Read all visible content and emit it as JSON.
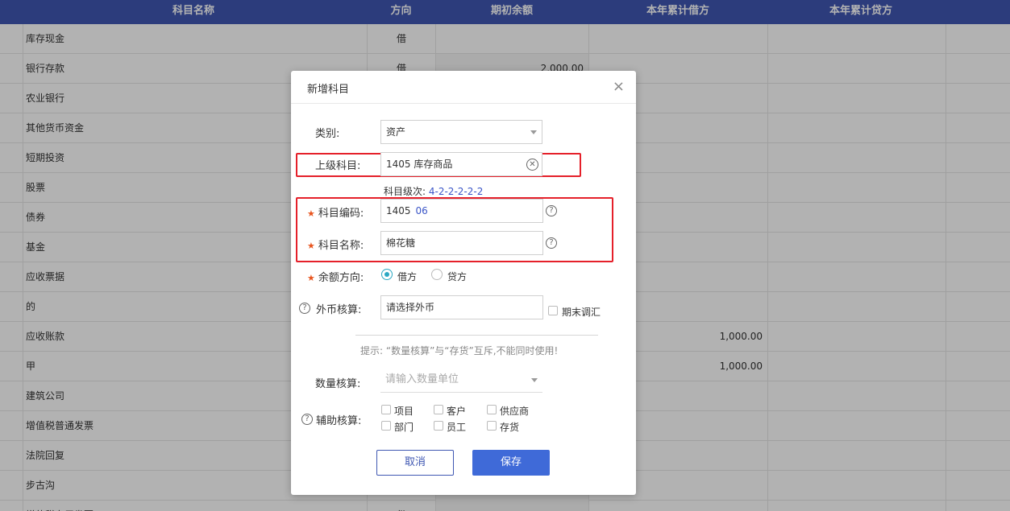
{
  "table": {
    "headers": {
      "name": "科目名称",
      "direction": "方向",
      "opening": "期初余额",
      "debit": "本年累计借方",
      "credit": "本年累计贷方"
    },
    "rows": [
      {
        "name": "库存现金",
        "direction": "借",
        "opening": "",
        "debit": ""
      },
      {
        "name": "银行存款",
        "direction": "借",
        "opening": "2,000.00",
        "debit": ""
      },
      {
        "name": "农业银行",
        "direction": "",
        "opening": "",
        "debit": ""
      },
      {
        "name": "其他货币资金",
        "direction": "",
        "opening": "",
        "debit": ""
      },
      {
        "name": "短期投资",
        "direction": "",
        "opening": "",
        "debit": ""
      },
      {
        "name": "股票",
        "direction": "",
        "opening": "",
        "debit": ""
      },
      {
        "name": "债券",
        "direction": "",
        "opening": "",
        "debit": ""
      },
      {
        "name": "基金",
        "direction": "",
        "opening": "",
        "debit": ""
      },
      {
        "name": "应收票据",
        "direction": "",
        "opening": "",
        "debit": ""
      },
      {
        "name": "的",
        "direction": "",
        "opening": "",
        "debit": ""
      },
      {
        "name": "应收账款",
        "direction": "",
        "opening": "",
        "debit": "1,000.00"
      },
      {
        "name": "甲",
        "direction": "",
        "opening": "",
        "debit": "1,000.00"
      },
      {
        "name": "建筑公司",
        "direction": "",
        "opening": "",
        "debit": ""
      },
      {
        "name": "增值税普通发票",
        "direction": "",
        "opening": "",
        "debit": ""
      },
      {
        "name": "法院回复",
        "direction": "",
        "opening": "",
        "debit": ""
      },
      {
        "name": "步古沟",
        "direction": "",
        "opening": "",
        "debit": ""
      },
      {
        "name": "增值税专用发票",
        "direction": "借",
        "opening": "",
        "debit": ""
      }
    ]
  },
  "dialog": {
    "title": "新增科目",
    "close_glyph": "×",
    "category_label": "类别:",
    "category_value": "资产",
    "parent_label": "上级科目:",
    "parent_value": "1405 库存商品",
    "level_prefix": "科目级次:",
    "level_first": "4",
    "level_rest": "-2-2-2-2-2",
    "code_label": "科目编码:",
    "code_prefix": "1405",
    "code_suffix": "06",
    "name_label": "科目名称:",
    "name_value": "棉花糖",
    "balance_label": "余额方向:",
    "balance_options": [
      "借方",
      "贷方"
    ],
    "balance_selected": "借方",
    "currency_label": "外币核算:",
    "currency_placeholder": "请选择外币",
    "period_end_label": "期末调汇",
    "hint": "提示: “数量核算”与“存货”互斥,不能同时使用!",
    "quantity_label": "数量核算:",
    "quantity_placeholder": "请输入数量单位",
    "aux_label": "辅助核算:",
    "aux_options": [
      "项目",
      "客户",
      "供应商",
      "部门",
      "员工",
      "存货"
    ],
    "cancel_label": "取消",
    "save_label": "保存"
  },
  "colors": {
    "header_bg": "#3f57b2",
    "accent": "#3f6ad8",
    "highlight_border": "#e5202a",
    "required": "#e8541e",
    "radio_on": "#2aa8c3"
  }
}
